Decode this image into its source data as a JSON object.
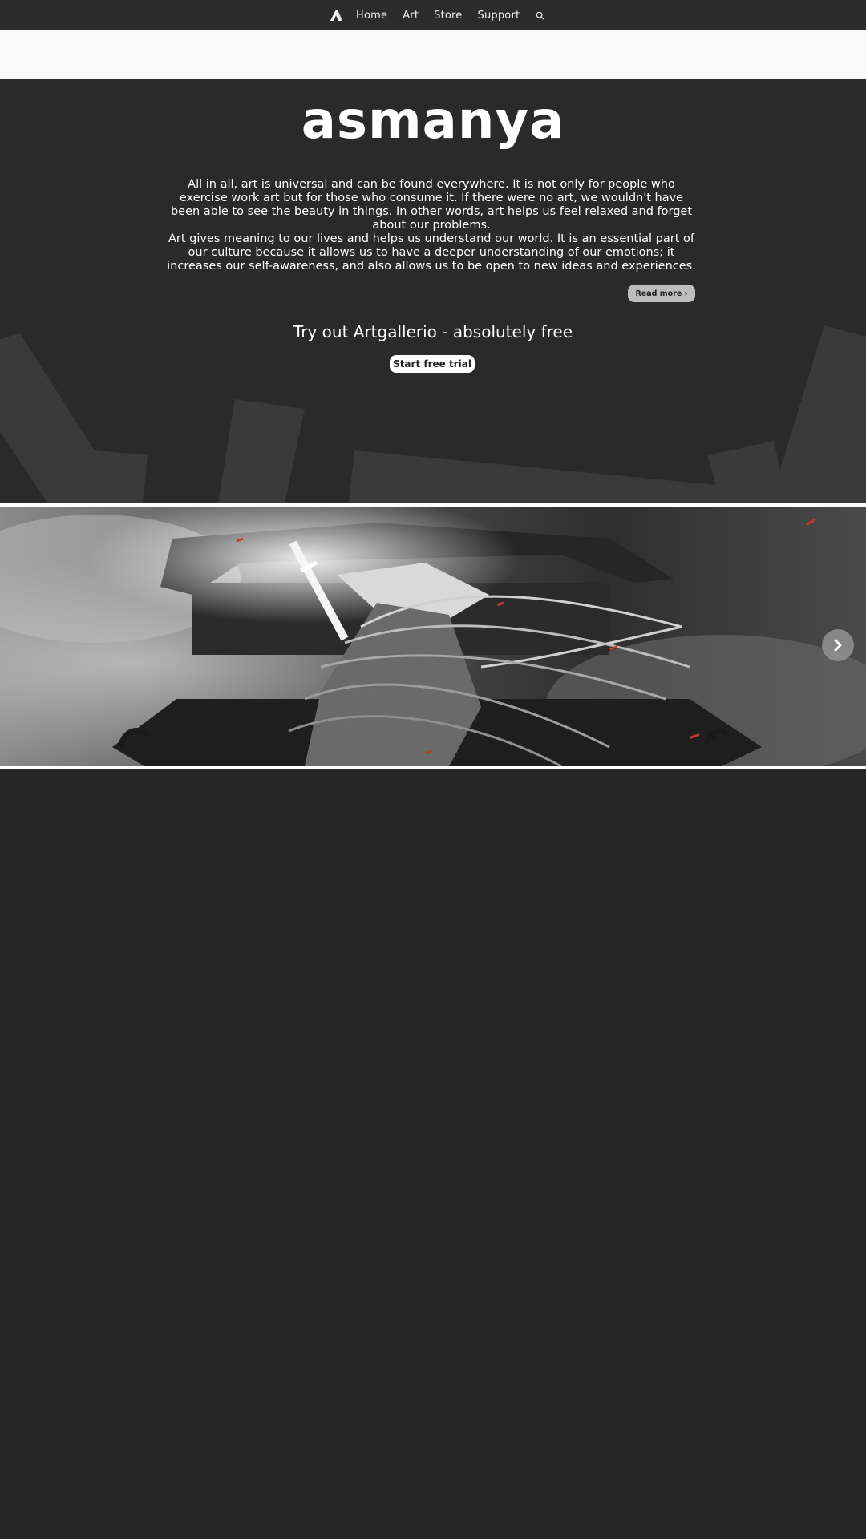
{
  "nav": {
    "logo_icon": "artgallerio-a-logo-icon",
    "links": [
      "Home",
      "Art",
      "Store",
      "Support"
    ],
    "search_icon": "search-icon"
  },
  "hero": {
    "brand": "asmanya",
    "paragraphs": [
      "All in all, art is universal and can be found everywhere. It is not only for people who exercise work art but for those who consume it. If there were no art, we wouldn't have been able to see the beauty in things. In other words, art helps us feel relaxed and forget about our problems.",
      "Art gives meaning to our lives and helps us understand our world. It is an essential part of our culture because it allows us to have a deeper understanding of our emotions; it increases our self-awareness, and also allows us to be open to new ideas and experiences."
    ],
    "read_more": "Read more ›",
    "cta": "Try out Artgallerio - absolutely free",
    "trial_button": "Start free trial"
  },
  "slider": {
    "image": "monochrome-samurai-artwork",
    "next_icon": "chevron-right-icon"
  },
  "colors": {
    "background": "#272727",
    "nav": "#2c2c2c",
    "band": "#fafafa",
    "read_more_bg": "#bdbdbd"
  }
}
